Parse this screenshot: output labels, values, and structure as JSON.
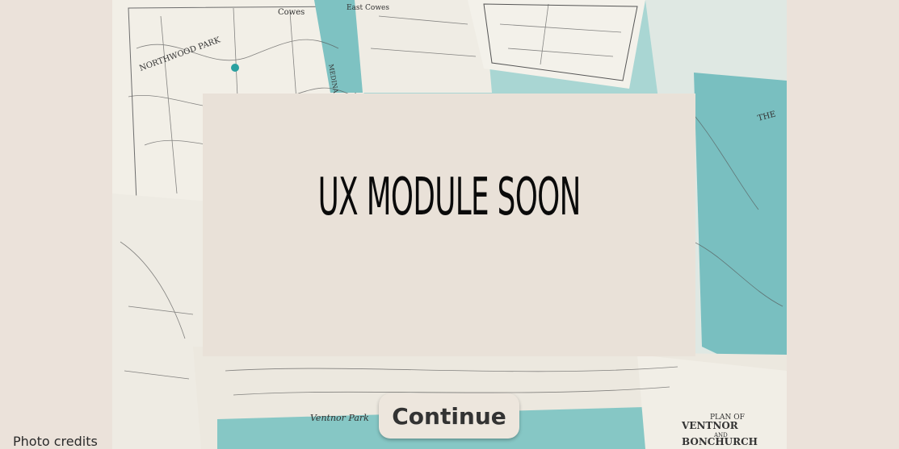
{
  "card": {
    "title": "UX MODULE SOON"
  },
  "actions": {
    "continue_label": "Continue"
  },
  "footer": {
    "photo_credits_label": "Photo credits"
  },
  "background": {
    "description_icon": "map-collage-icon",
    "map_labels": {
      "northwood_park": "NORTHWOOD PARK",
      "cowes": "Cowes",
      "east_cowes": "East Cowes",
      "medina": "MEDINA",
      "ventnor_title": "PLAN OF",
      "ventnor": "VENTNOR",
      "and": "AND",
      "bonchurch": "BONCHURCH",
      "ventnor_park": "Ventnor Park",
      "the": "THE"
    }
  },
  "colors": {
    "page_bg": "#ebe2da",
    "card_bg": "#e9e1d8",
    "map_paper": "#ede9df",
    "sea_teal": "#7fc4c4",
    "ink": "#0a0a0a",
    "button_text": "#333333"
  }
}
